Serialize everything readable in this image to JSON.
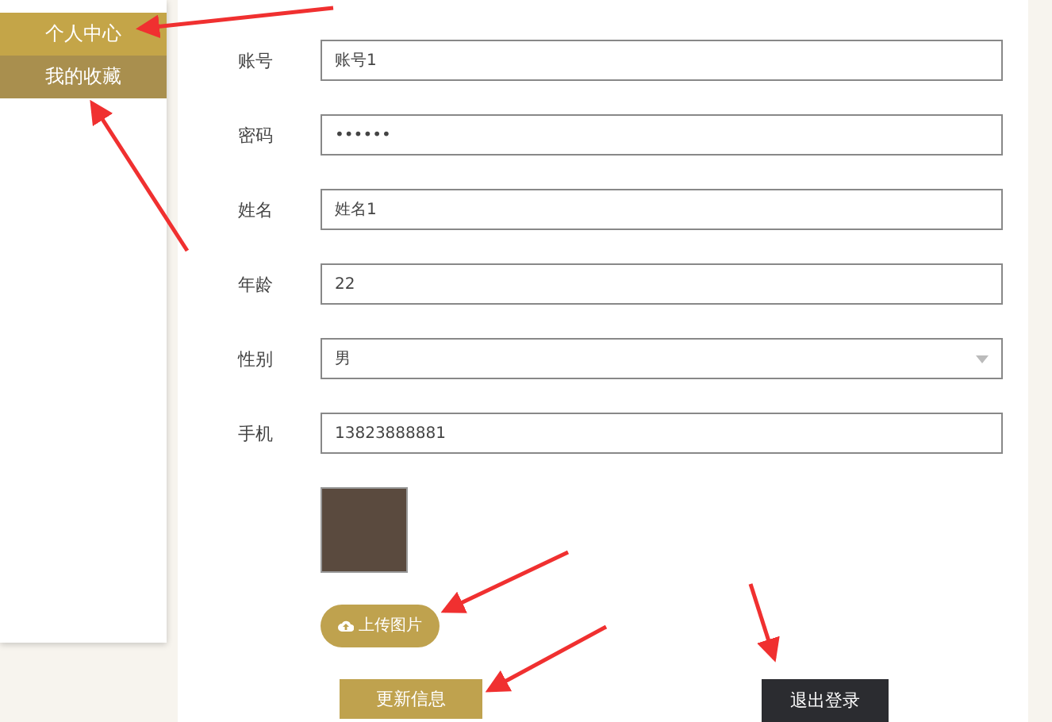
{
  "sidebar": {
    "items": [
      {
        "label": "个人中心",
        "selected": true
      },
      {
        "label": "我的收藏",
        "selected": false
      }
    ]
  },
  "form": {
    "fields": [
      {
        "label": "账号",
        "kind": "text",
        "value": "账号1"
      },
      {
        "label": "密码",
        "kind": "text",
        "value": "••••••"
      },
      {
        "label": "姓名",
        "kind": "text",
        "value": "姓名1"
      },
      {
        "label": "年龄",
        "kind": "text",
        "value": "22"
      },
      {
        "label": "性别",
        "kind": "select",
        "value": "男"
      },
      {
        "label": "手机",
        "kind": "text",
        "value": "13823888881"
      }
    ],
    "upload_button": "上传图片",
    "update_button": "更新信息",
    "logout_button": "退出登录"
  }
}
